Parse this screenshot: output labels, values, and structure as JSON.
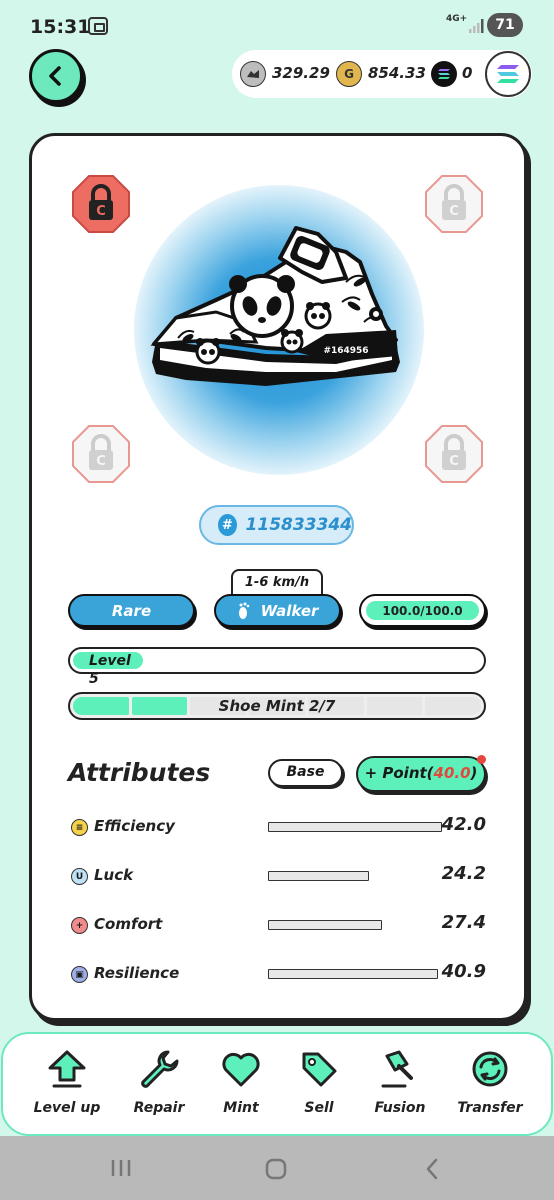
{
  "status_bar": {
    "time": "15:31",
    "network": "4G+",
    "battery": "71"
  },
  "header": {
    "back_icon": "chevron-left-icon",
    "balances": [
      {
        "icon": "gst-token-icon",
        "value": "329.29"
      },
      {
        "icon": "gmt-token-icon",
        "value": "854.33"
      },
      {
        "icon": "solana-icon",
        "value": "0"
      }
    ],
    "chain_icon": "solana-icon"
  },
  "sneaker": {
    "serial": "#164956",
    "id": "115833344",
    "id_hash": "#",
    "speed_range": "1-6 km/h",
    "rarity": "Rare",
    "type": "Walker",
    "durability": "100.0/100.0",
    "durability_fraction": 1.0,
    "level_label": "Level 5",
    "mint_label": "Shoe Mint 2/7",
    "mint_count": 2,
    "mint_total": 7,
    "gem_sockets": [
      {
        "state": "unlocked-red"
      },
      {
        "state": "locked"
      },
      {
        "state": "locked"
      },
      {
        "state": "locked"
      }
    ],
    "colors": {
      "accent": "#5ef0bb",
      "rarity_blue": "#3aa4d9",
      "socket_red": "#e8453c"
    }
  },
  "attributes": {
    "title": "Attributes",
    "base_label": "Base",
    "point_label": "+ Point(",
    "point_value": "40.0",
    "point_close": ")",
    "items": [
      {
        "name": "Efficiency",
        "value": "42.0",
        "icon_glyph": "≡",
        "icon_color": "#f5d24a"
      },
      {
        "name": "Luck",
        "value": "24.2",
        "icon_glyph": "U",
        "icon_color": "#bfe1f5"
      },
      {
        "name": "Comfort",
        "value": "27.4",
        "icon_glyph": "+",
        "icon_color": "#f08c8c"
      },
      {
        "name": "Resilience",
        "value": "40.9",
        "icon_glyph": "▣",
        "icon_color": "#9eaee6"
      }
    ]
  },
  "bottom_nav": [
    {
      "label": "Level up",
      "icon": "level-up-arrow-icon"
    },
    {
      "label": "Repair",
      "icon": "wrench-icon"
    },
    {
      "label": "Mint",
      "icon": "heart-icon"
    },
    {
      "label": "Sell",
      "icon": "price-tag-icon"
    },
    {
      "label": "Fusion",
      "icon": "hammer-icon"
    },
    {
      "label": "Transfer",
      "icon": "transfer-cycle-icon"
    }
  ],
  "android_nav": [
    {
      "icon": "recents-icon"
    },
    {
      "icon": "home-icon"
    },
    {
      "icon": "back-icon"
    }
  ]
}
